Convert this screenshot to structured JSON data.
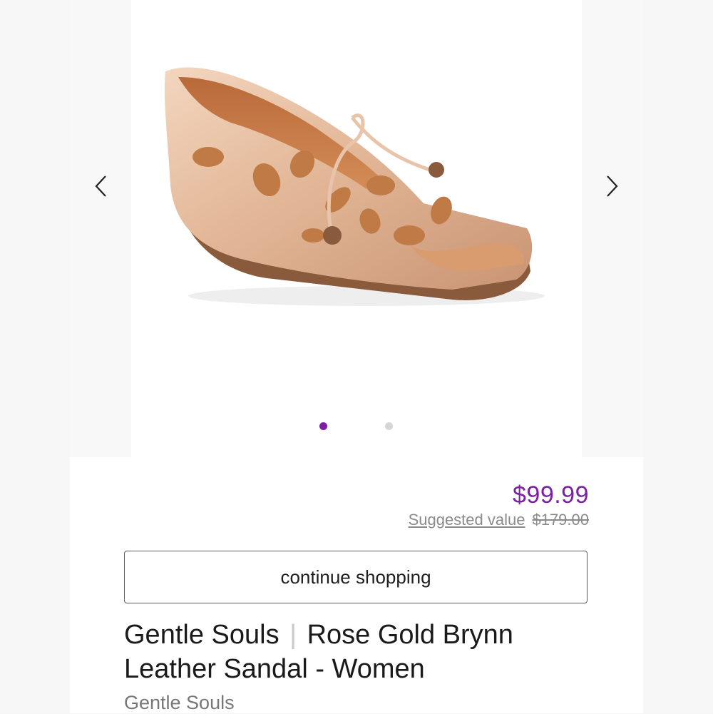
{
  "gallery": {
    "prev_icon": "chevron-left-icon",
    "next_icon": "chevron-right-icon",
    "slide_count": 2,
    "active_slide": 1,
    "active_dot_color": "#7c1fa5",
    "inactive_dot_color": "#d6d6d6"
  },
  "price": {
    "current": "$99.99",
    "suggested_label": "Suggested value",
    "original": "$179.00",
    "accent_color": "#7c1fa5"
  },
  "actions": {
    "continue_label": "continue shopping"
  },
  "product": {
    "brand": "Gentle Souls",
    "separator": "|",
    "name_line1": "Rose Gold Brynn",
    "name_line2": "Leather Sandal - Women",
    "brand_link": "Gentle Souls"
  }
}
